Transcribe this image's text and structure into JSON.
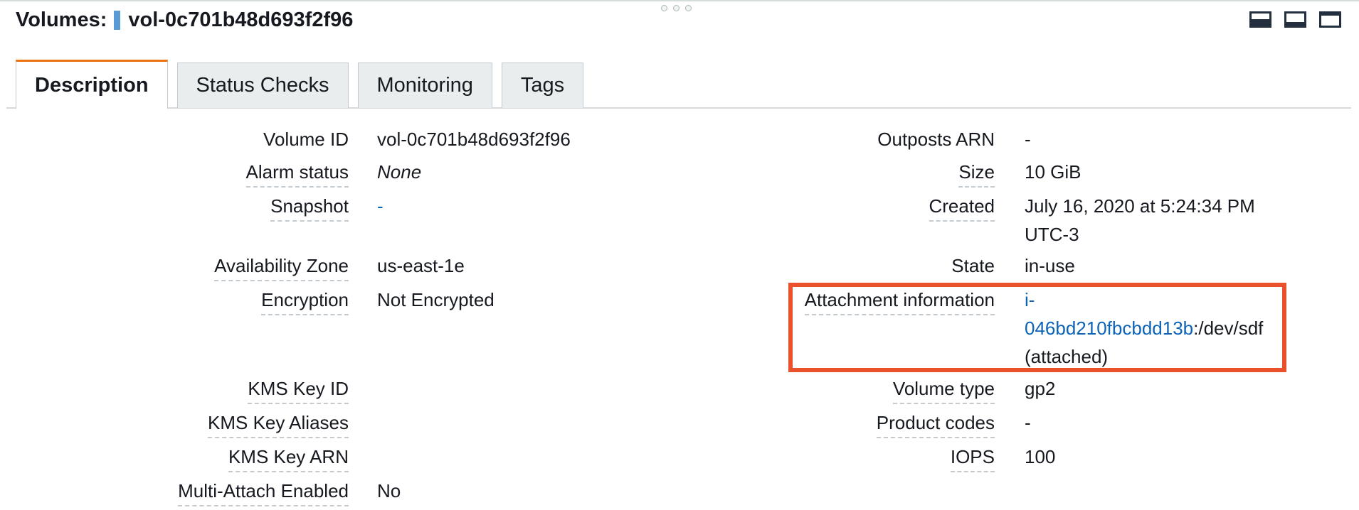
{
  "header": {
    "title_prefix": "Volumes:",
    "volume_id": "vol-0c701b48d693f2f96"
  },
  "layout_icons": [
    "layout-bottom-icon",
    "layout-half-icon",
    "layout-maximize-icon"
  ],
  "tabs": [
    {
      "label": "Description",
      "active": true
    },
    {
      "label": "Status Checks",
      "active": false
    },
    {
      "label": "Monitoring",
      "active": false
    },
    {
      "label": "Tags",
      "active": false
    }
  ],
  "left_fields": {
    "volume_id": {
      "label": "Volume ID",
      "value": "vol-0c701b48d693f2f96"
    },
    "alarm_status": {
      "label": "Alarm status",
      "value": "None"
    },
    "snapshot": {
      "label": "Snapshot",
      "value": "-"
    },
    "availability_zone": {
      "label": "Availability Zone",
      "value": "us-east-1e"
    },
    "encryption": {
      "label": "Encryption",
      "value": "Not Encrypted"
    },
    "kms_key_id": {
      "label": "KMS Key ID",
      "value": ""
    },
    "kms_key_aliases": {
      "label": "KMS Key Aliases",
      "value": ""
    },
    "kms_key_arn": {
      "label": "KMS Key ARN",
      "value": ""
    },
    "multi_attach": {
      "label": "Multi-Attach Enabled",
      "value": "No"
    }
  },
  "right_fields": {
    "outposts_arn": {
      "label": "Outposts ARN",
      "value": "-"
    },
    "size": {
      "label": "Size",
      "value": "10 GiB"
    },
    "created": {
      "label": "Created",
      "value_line1": "July 16, 2020 at 5:24:34 PM",
      "value_line2": "UTC-3"
    },
    "state": {
      "label": "State",
      "value": "in-use"
    },
    "attachment": {
      "label": "Attachment information",
      "instance_part1": "i-",
      "instance_part2": "046bd210fbcbdd13b",
      "device": ":/dev/sdf",
      "status": "(attached)"
    },
    "volume_type": {
      "label": "Volume type",
      "value": "gp2"
    },
    "product_codes": {
      "label": "Product codes",
      "value": "-"
    },
    "iops": {
      "label": "IOPS",
      "value": "100"
    }
  },
  "colors": {
    "accent_tab": "#ec7211",
    "link": "#0d63b5",
    "highlight": "#e8512c",
    "title_marker": "#5b9bd5"
  }
}
